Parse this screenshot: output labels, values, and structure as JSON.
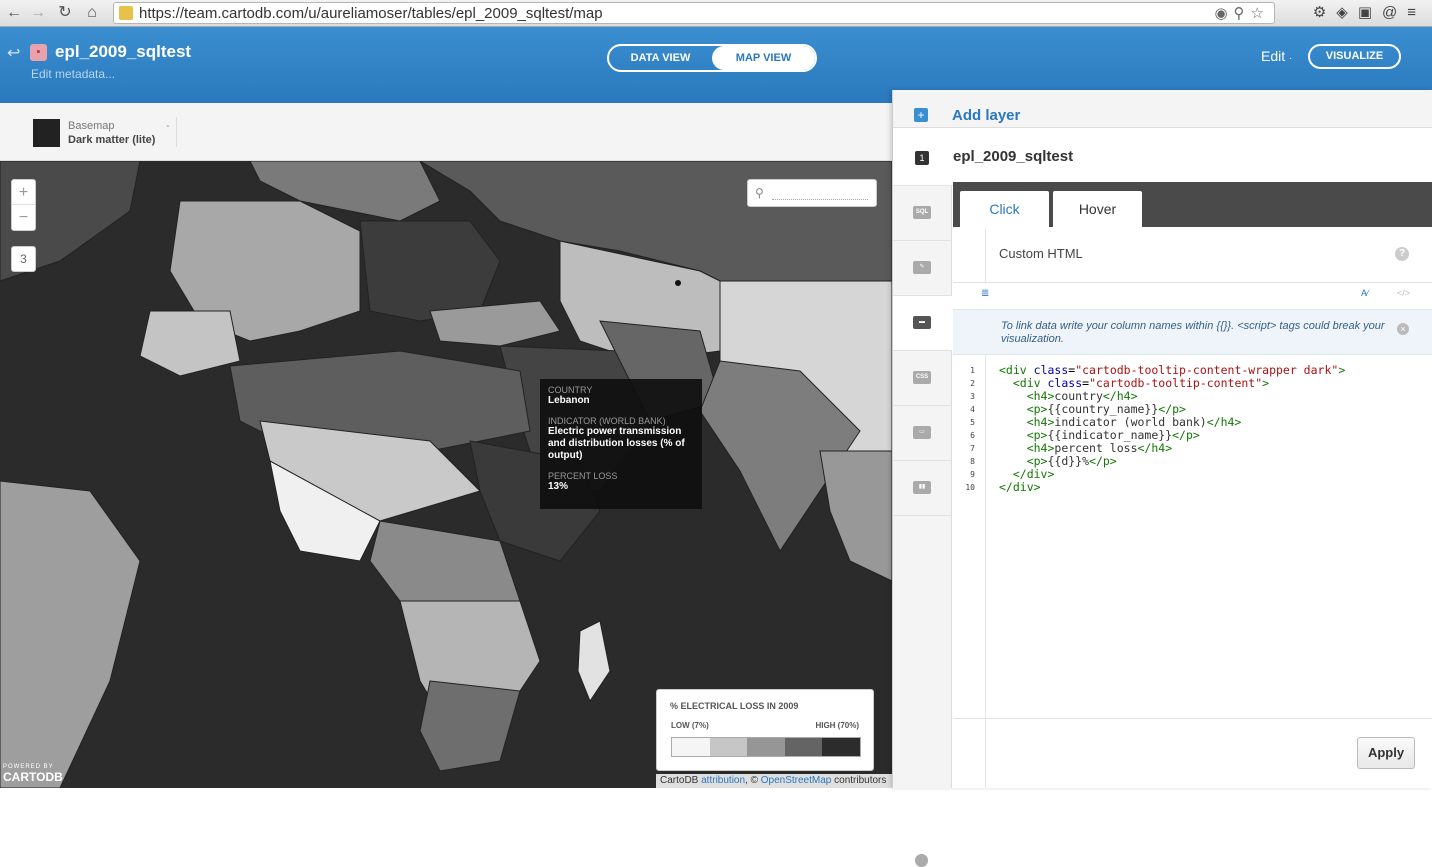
{
  "browser": {
    "url": "https://team.cartodb.com/u/aureliamoser/tables/epl_2009_sqltest/map",
    "back_icon": "back-arrow-icon",
    "forward_icon": "forward-arrow-icon",
    "reload_icon": "reload-icon",
    "home_icon": "home-icon"
  },
  "header": {
    "table_title": "epl_2009_sqltest",
    "edit_metadata": "Edit metadata...",
    "data_view": "DATA VIEW",
    "map_view": "MAP VIEW",
    "edit": "Edit",
    "edit_caret": "·",
    "visualize": "VISUALIZE"
  },
  "basemap": {
    "label": "Basemap",
    "name": "Dark matter (lite)",
    "caret": "-"
  },
  "map": {
    "zoom_in": "+",
    "zoom_out": "−",
    "zoom_level": "3",
    "search_placeholder": "",
    "tooltip": {
      "h1": "COUNTRY",
      "v1": "Lebanon",
      "h2": "INDICATOR (WORLD BANK)",
      "v2": "Electric power transmission and distribution losses (% of output)",
      "h3": "PERCENT LOSS",
      "v3": "13%"
    },
    "legend": {
      "title": "% ELECTRICAL LOSS IN 2009",
      "low": "LOW (7%)",
      "high": "HIGH (70%)",
      "colors": [
        "#f5f5f5",
        "#c6c6c6",
        "#969696",
        "#646464",
        "#2c2c2c"
      ]
    },
    "powered_by": "POWERED BY",
    "brand": "CARTODB",
    "attribution_prefix": "CartoDB ",
    "attribution_link": "attribution",
    "attribution_mid": ", © ",
    "attribution_osm": "OpenStreetMap",
    "attribution_suffix": " contributors"
  },
  "panel": {
    "add_layer": "Add layer",
    "layer_number": "1",
    "layer_name": "epl_2009_sqltest",
    "tools": [
      "SQL",
      "wizard",
      "infowindow",
      "CSS",
      "legend",
      "filters"
    ],
    "tab_click": "Click",
    "tab_hover": "Hover",
    "custom_html": "Custom HTML",
    "help": "?",
    "info_text": "To link data write your column names within {{}}. <script> tags could break your visualization.",
    "info_close": "×",
    "apply": "Apply",
    "code_lines": [
      "1",
      "2",
      "3",
      "4",
      "5",
      "6",
      "7",
      "8",
      "9",
      "10"
    ]
  },
  "colors": {
    "header_blue": "#2a78bd",
    "map_background": "#2b2b2b"
  }
}
